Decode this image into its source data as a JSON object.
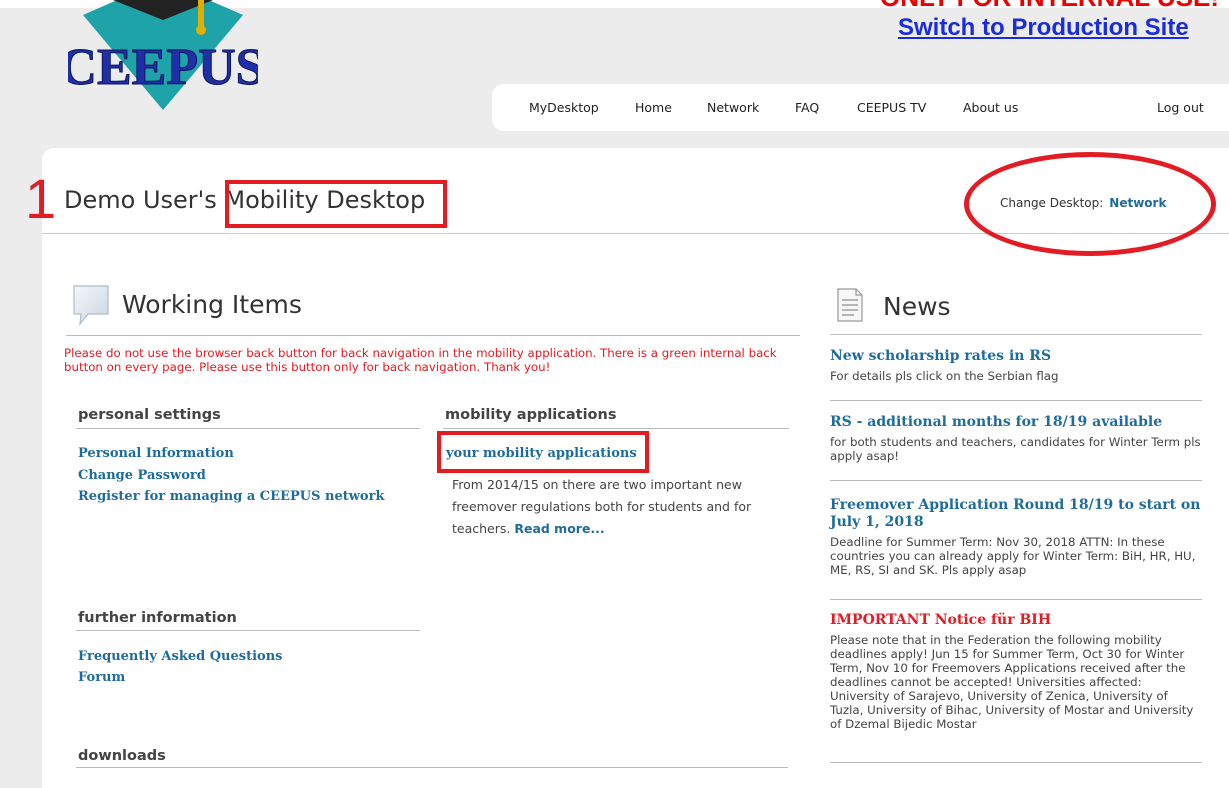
{
  "header": {
    "top_text": "ONLY FOR INTERNAL USE!",
    "switch_label": "Switch to Production Site",
    "logo_text": "CEEPUS"
  },
  "nav": {
    "items": [
      {
        "label": "MyDesktop"
      },
      {
        "label": "Home"
      },
      {
        "label": "Network"
      },
      {
        "label": "FAQ"
      },
      {
        "label": "CEEPUS TV"
      },
      {
        "label": "About us"
      }
    ],
    "logout": "Log out"
  },
  "page": {
    "annotation_number": "1",
    "title_user": "Demo User's ",
    "title_main": "Mobility Desktop",
    "change_desktop_label": "Change Desktop:",
    "change_desktop_link": "Network"
  },
  "working_items": {
    "title": "Working Items",
    "warning": "Please do not use the browser back button for back navigation in the mobility application. There is a green internal back button on every page. Please use this button only for back navigation. Thank you!",
    "personal_settings": {
      "heading": "personal settings",
      "links": [
        "Personal Information",
        "Change Password",
        "Register for managing a CEEPUS network"
      ]
    },
    "mobility_applications": {
      "heading": "mobility applications",
      "link": "your mobility applications",
      "desc": "From 2014/15 on there are two important new freemover regulations both for students and for teachers. ",
      "read_more": "Read more..."
    },
    "further_information": {
      "heading": "further information",
      "links": [
        "Frequently Asked Questions",
        "Forum"
      ]
    },
    "downloads": {
      "heading": "downloads"
    }
  },
  "news": {
    "title": "News",
    "items": [
      {
        "title": "New scholarship rates in RS",
        "body": "For details pls click on the Serbian flag"
      },
      {
        "title": "RS - additional months for 18/19 available",
        "body": "for both students and teachers, candidates for Winter Term pls apply asap!"
      },
      {
        "title": "Freemover Application Round 18/19 to start on July 1, 2018",
        "body": "Deadline for Summer Term: Nov 30, 2018 ATTN: In these countries you can already apply for Winter Term: BiH, HR, HU, ME, RS, SI and SK. Pls apply asap"
      },
      {
        "title": "IMPORTANT Notice für BIH",
        "body": "Please note that in the Federation the following mobility deadlines apply! Jun 15 for Summer Term, Oct 30 for Winter Term, Nov 10 for Freemovers Applications received after the deadlines cannot be accepted! Universities affected: University of Sarajevo, University of Zenica, University of Tuzla, University of Bihac, University of Mostar and University of Dzemal Bijedic Mostar"
      }
    ]
  },
  "colors": {
    "link": "#1f6c9a",
    "annotation_red": "#e31b23",
    "switch_link": "#1a2be0"
  }
}
